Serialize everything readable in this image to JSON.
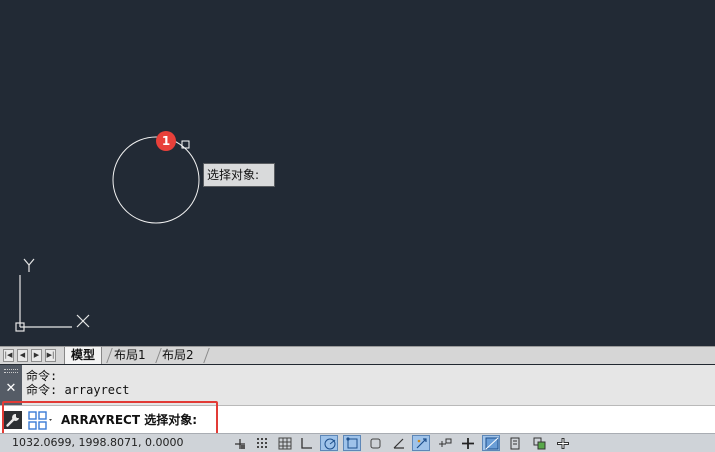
{
  "canvas": {
    "step_badge": "1",
    "tooltip": "选择对象:",
    "ucs_x_label": "X",
    "ucs_y_label": "Y"
  },
  "tabs": {
    "items": [
      {
        "label": "模型",
        "active": true
      },
      {
        "label": "布局1",
        "active": false
      },
      {
        "label": "布局2",
        "active": false
      }
    ],
    "nav_buttons": [
      "first-icon",
      "prev-icon",
      "next-icon",
      "last-icon"
    ]
  },
  "command_window": {
    "history": [
      "命令:",
      "命令:  arrayrect"
    ],
    "prompt": "ARRAYRECT 选择对象:",
    "close_icon": "close-icon",
    "tool_icon": "wrench-icon"
  },
  "status_bar": {
    "coordinates": "1032.0699,  1998.8071,  0.0000",
    "buttons": [
      "infer-constraints-icon",
      "snap-icon",
      "grid-icon",
      "ortho-icon",
      "polar-icon",
      "osnap-icon",
      "3d-osnap-icon",
      "otrack-icon",
      "ducs-icon",
      "dyn-icon",
      "lineweight-icon",
      "transparency-icon",
      "quick-properties-icon",
      "selection-cycling-icon",
      "annotation-monitor-icon"
    ]
  },
  "colors": {
    "canvas_bg": "#222a35",
    "badge": "#e8403a",
    "highlight": "#e23b36"
  }
}
